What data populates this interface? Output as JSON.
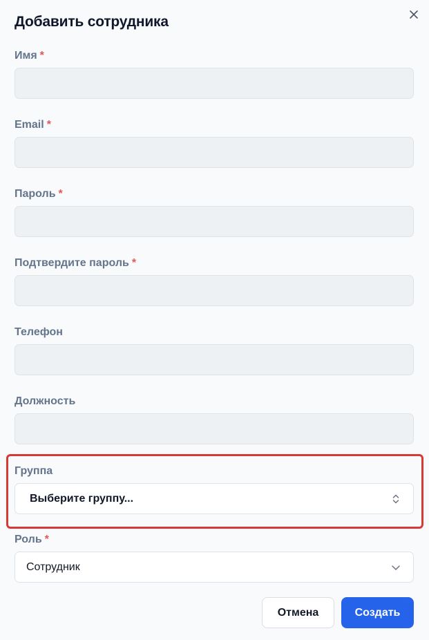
{
  "dialog": {
    "title": "Добавить сотрудника",
    "close_icon": "close-icon"
  },
  "fields": {
    "name": {
      "label": "Имя",
      "required_mark": "*",
      "value": ""
    },
    "email": {
      "label": "Email",
      "required_mark": "*",
      "value": ""
    },
    "password": {
      "label": "Пароль",
      "required_mark": "*",
      "value": ""
    },
    "confirm_password": {
      "label": "Подтвердите пароль",
      "required_mark": "*",
      "value": ""
    },
    "phone": {
      "label": "Телефон",
      "value": ""
    },
    "position": {
      "label": "Должность",
      "value": ""
    },
    "group": {
      "label": "Группа",
      "selected": "Выберите группу...",
      "icon": "chevron-up-down-icon"
    },
    "role": {
      "label": "Роль",
      "required_mark": "*",
      "selected": "Сотрудник",
      "icon": "chevron-down-icon"
    }
  },
  "buttons": {
    "cancel_label": "Отмена",
    "create_label": "Создать"
  },
  "colors": {
    "primary": "#2563eb",
    "required": "#e25858",
    "highlight_border": "#d63a34",
    "input_bg": "#eef1f4"
  }
}
